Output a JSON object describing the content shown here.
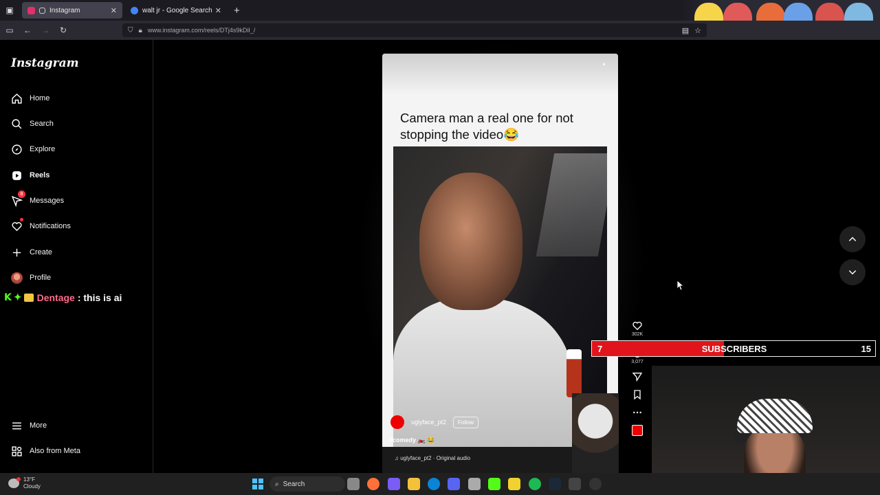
{
  "browser": {
    "tabs": [
      {
        "title": "Instagram",
        "active": true,
        "favicon_color": "#e1306c"
      },
      {
        "title": "walt jr - Google Search",
        "active": false,
        "favicon_color": "#4285f4"
      }
    ],
    "url": "www.instagram.com/reels/DTj4s9kDiI_/"
  },
  "instagram": {
    "logo": "Instagram",
    "nav": [
      {
        "label": "Home",
        "icon": "home-icon"
      },
      {
        "label": "Search",
        "icon": "search-icon"
      },
      {
        "label": "Explore",
        "icon": "compass-icon"
      },
      {
        "label": "Reels",
        "icon": "reels-icon",
        "active": true
      },
      {
        "label": "Messages",
        "icon": "messenger-icon",
        "badge": "8"
      },
      {
        "label": "Notifications",
        "icon": "heart-icon"
      },
      {
        "label": "Create",
        "icon": "plus-icon"
      },
      {
        "label": "Profile",
        "icon": "avatar"
      }
    ],
    "bottom_nav": [
      {
        "label": "More",
        "icon": "menu-icon"
      },
      {
        "label": "Also from Meta",
        "icon": "meta-icon"
      }
    ]
  },
  "chat_overlay": {
    "username": "Dentage",
    "message": ": this is ai"
  },
  "reel": {
    "caption": "Camera man a real one for not stopping the video😂",
    "username": "uglyface_pt2",
    "follow_label": "Follow",
    "hashtags": "#comedy 🏍️ 😂",
    "audio": "♫ uglyface_pt2 · Original audio",
    "like_count": "302K",
    "comment_count": "3,077"
  },
  "stream_overlay": {
    "subs_current": "7",
    "subs_label": "SUBSCRIBERS",
    "subs_goal": "15",
    "subs_progress": 0.4667,
    "fill_color": "#e0151b"
  },
  "taskbar": {
    "temperature": "13°F",
    "condition": "Cloudy",
    "search_label": "Search"
  }
}
